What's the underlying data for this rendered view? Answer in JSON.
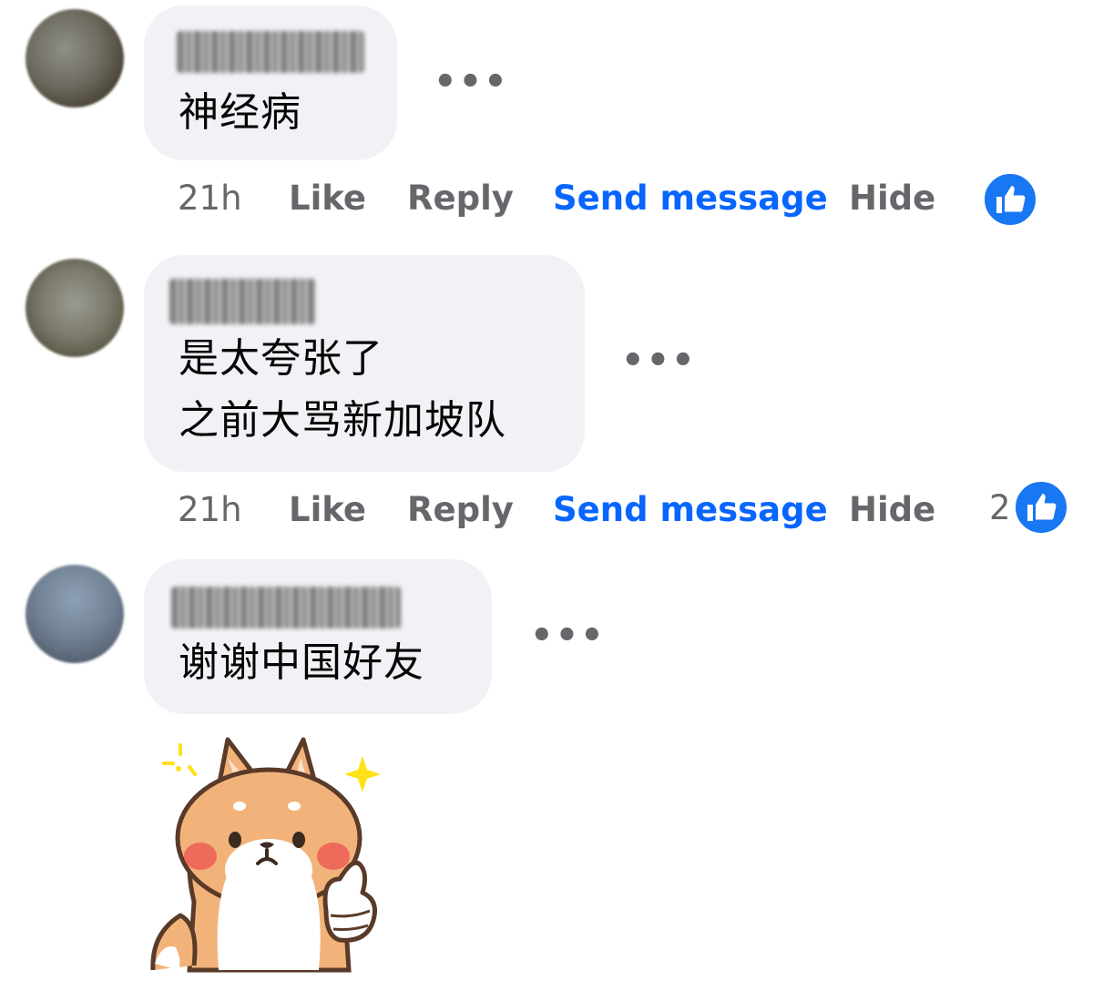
{
  "comments": [
    {
      "text": "神经病",
      "time": "21h",
      "like": "Like",
      "reply": "Reply",
      "send": "Send message",
      "hide": "Hide",
      "more": "•••",
      "reaction_count": ""
    },
    {
      "text": "是太夸张了\n之前大骂新加坡队",
      "time": "21h",
      "like": "Like",
      "reply": "Reply",
      "send": "Send message",
      "hide": "Hide",
      "more": "•••",
      "reaction_count": "2"
    },
    {
      "text": "谢谢中国好友",
      "more": "•••",
      "sticker_icon": "shiba-dog-thumbs-up-sticker"
    }
  ],
  "colors": {
    "bubble": "#f0f2f5",
    "link_blue": "#0866ff",
    "action_gray": "#65676b",
    "like_blue": "#1877f2"
  },
  "icons": {
    "reaction": "thumbs-up-icon",
    "more": "more-options-icon"
  }
}
